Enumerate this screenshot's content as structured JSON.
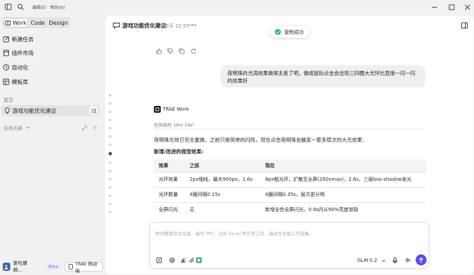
{
  "menu": {
    "edit": "编辑(E)",
    "help": "帮助(H)"
  },
  "sidebar": {
    "tabs": [
      "Work",
      "Code",
      "Design"
    ],
    "items": [
      "新建任务",
      "插件市场",
      "自动化",
      "模板库"
    ],
    "pinned_section": "置顶",
    "pinned_item": "游戏功能优化建议",
    "task_section": "任务列表",
    "user_name": "爱吃螺蛳...",
    "plan_badge": "Pro+",
    "mobile_button": "TRAE 移动端"
  },
  "chat": {
    "title": "游戏功能优化建议",
    "time": "昨天 22:55",
    "toast": "复制成功",
    "user_message": "夜明珠的光涡效果做得太差了吧。做成鼠标点击会出现三四圈大光环比直接一闪一闪的效果好",
    "assistant_name": "TRAE Work",
    "duration": "任务耗时 26m 59s",
    "reply_intro": "夜明珠光效已完全重做。之前只是简单的闪烁，现在点击夜明珠会触发一套多层次的大光效果:",
    "reply_heading": "新增/改进的视觉效果:",
    "table": {
      "headers": [
        "效果",
        "之前",
        "现在"
      ],
      "rows": [
        [
          "光环效果",
          "2px细线，最大900px，1.6s",
          "8px粗光环，扩散至全屏(250vmax)，2.6s，三层box-shadow发光"
        ],
        [
          "光环数量",
          "4圈间隔0.15s",
          "4圈间隔0.35s，层次更分明"
        ],
        [
          "全屏闪光",
          "无",
          "新增全色全屏闪光，0.9s内从90%亮度渐隐"
        ]
      ]
    }
  },
  "composer": {
    "placeholder": "帮你整理论文综述、编写 PPT、分析 Excel 等日常工作，输出专业级工作成果。",
    "model": "GLM-5.2"
  },
  "colors": {
    "accent": "#5b4ef0",
    "toast_ok": "#2eb872",
    "selected": "#e3e3e6"
  }
}
